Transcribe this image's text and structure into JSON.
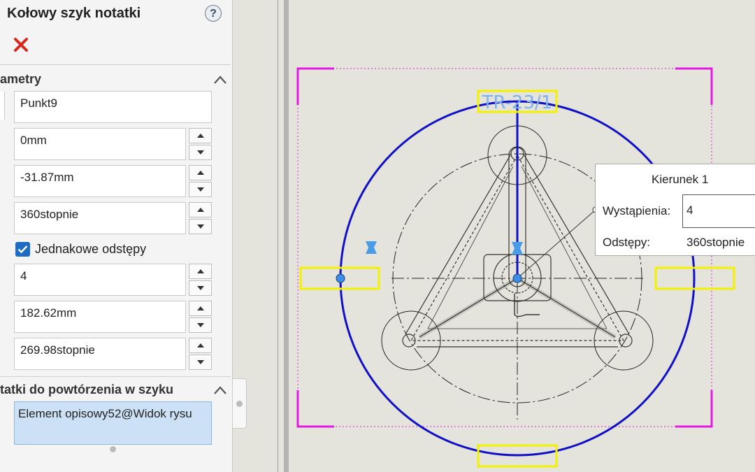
{
  "panel": {
    "title": "Kołowy szyk notatki",
    "help_icon": "?",
    "close_icon": "close-x-icon",
    "section_params": "ametry",
    "point_name": "Punkt9",
    "x_value": "0mm",
    "y_value": "-31.87mm",
    "angle_value": "360stopnie",
    "equal_spacing_label": "Jednakowe odstępy",
    "equal_spacing_checked": true,
    "instances": "4",
    "radius": "182.62mm",
    "start_angle": "269.98stopnie",
    "section_notes": "tatki do powtórzenia w szyku",
    "notes_selected": "Element opisowy52@Widok rysu"
  },
  "viewport": {
    "note_text": "TR-23/1"
  },
  "popup": {
    "title": "Kierunek 1",
    "instances_label": "Wystąpienia:",
    "instances_value": "4",
    "spacing_label": "Odstępy:",
    "spacing_value": "360stopnie"
  },
  "colors": {
    "accent": "#1c6bc4",
    "magenta": "#e11be1",
    "blue_circle": "#1010c8",
    "yellow": "#f2f200"
  }
}
